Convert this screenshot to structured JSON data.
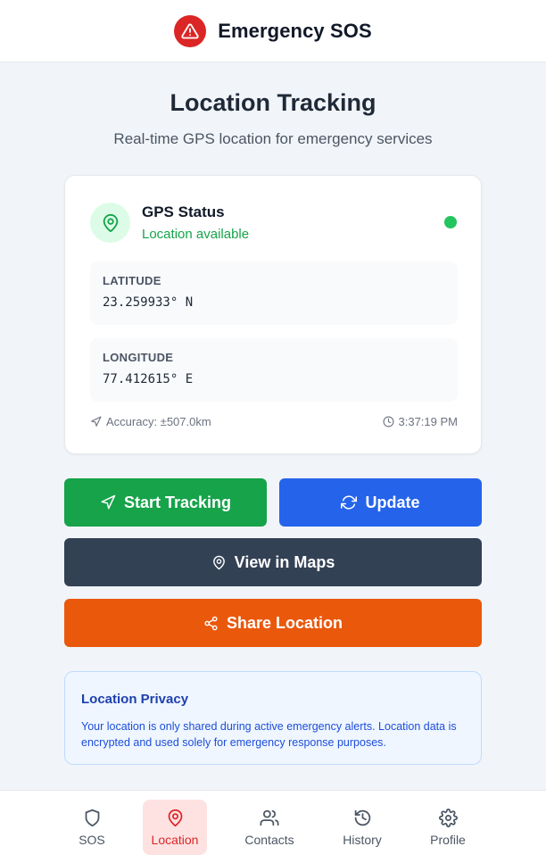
{
  "header": {
    "title": "Emergency SOS",
    "logo_icon": "warning-triangle-icon",
    "logo_color": "#dc2626"
  },
  "page": {
    "title": "Location Tracking",
    "subtitle": "Real-time GPS location for emergency services"
  },
  "gps": {
    "title": "GPS Status",
    "status": "Location available",
    "status_color": "#22c55e",
    "latitude_label": "LATITUDE",
    "latitude_value": "23.259933° N",
    "longitude_label": "LONGITUDE",
    "longitude_value": "77.412615° E",
    "accuracy": "Accuracy: ±507.0km",
    "timestamp": "3:37:19 PM"
  },
  "actions": {
    "start_tracking": "Start Tracking",
    "update": "Update",
    "view_maps": "View in Maps",
    "share_location": "Share Location",
    "colors": {
      "start": "#16a34a",
      "update": "#2563eb",
      "maps": "#334155",
      "share": "#ea580c"
    }
  },
  "privacy": {
    "title": "Location Privacy",
    "text": "Your location is only shared during active emergency alerts. Location data is encrypted and used solely for emergency response purposes."
  },
  "nav": {
    "items": [
      {
        "label": "SOS",
        "icon": "shield-icon",
        "active": false
      },
      {
        "label": "Location",
        "icon": "map-pin-icon",
        "active": true
      },
      {
        "label": "Contacts",
        "icon": "users-icon",
        "active": false
      },
      {
        "label": "History",
        "icon": "history-icon",
        "active": false
      },
      {
        "label": "Profile",
        "icon": "gear-icon",
        "active": false
      }
    ]
  }
}
